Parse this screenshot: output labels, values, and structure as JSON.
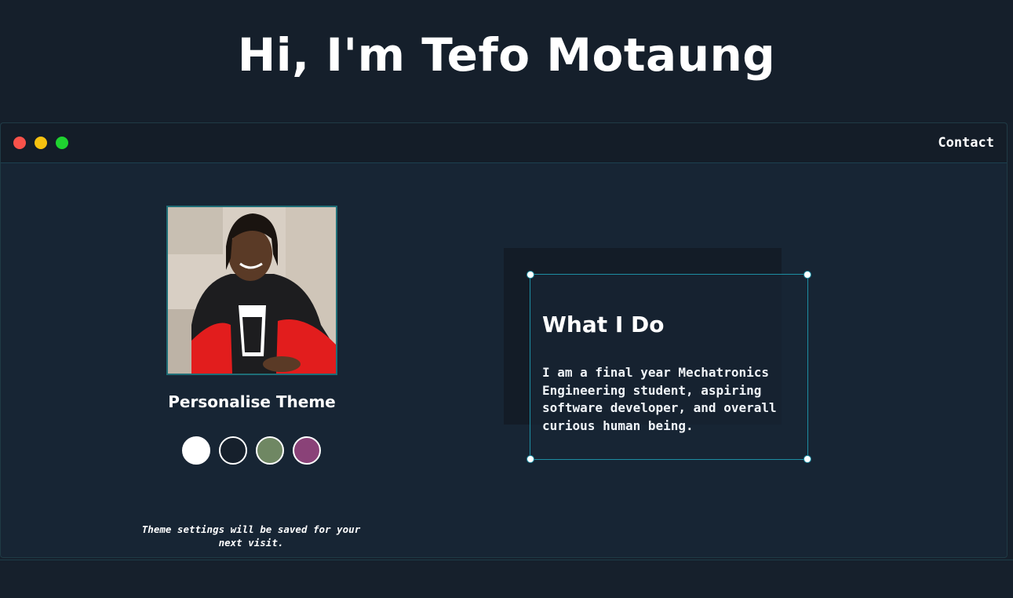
{
  "header": {
    "title": "Hi, I'm Tefo Motaung"
  },
  "window": {
    "controls": [
      "close-dot",
      "minimize-dot",
      "maximize-dot"
    ],
    "contact_label": "Contact"
  },
  "profile": {
    "photo_icon": "profile-photo"
  },
  "theme": {
    "title": "Personalise Theme",
    "swatches": [
      {
        "name": "light",
        "color": "#ffffff"
      },
      {
        "name": "dark",
        "color": "#16202c"
      },
      {
        "name": "green",
        "color": "#6f8763"
      },
      {
        "name": "purple",
        "color": "#8a4278"
      }
    ],
    "note": "Theme settings will be saved for your next visit."
  },
  "about": {
    "title": "What I Do",
    "text": "I am a final year Mechatronics Engineering student, aspiring software developer, and overall curious human being."
  },
  "colors": {
    "background": "#16202c",
    "accent": "#1d8ea3",
    "window_bg": "#172534"
  }
}
